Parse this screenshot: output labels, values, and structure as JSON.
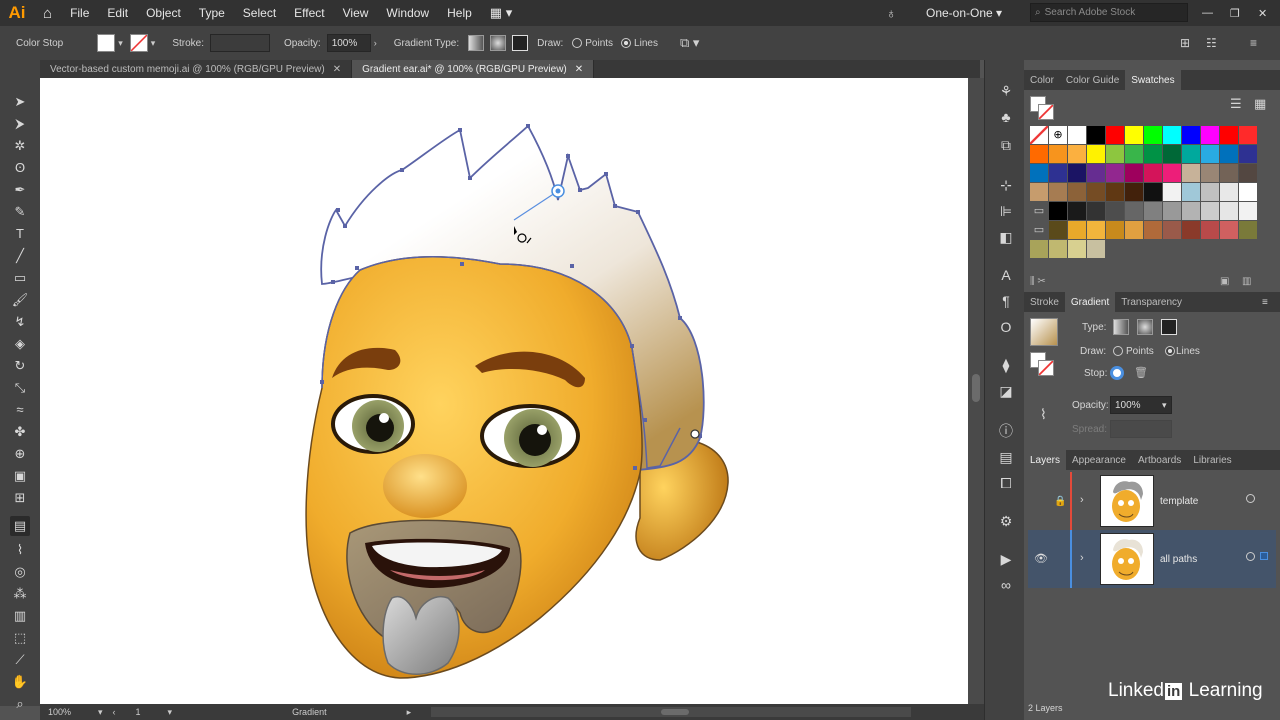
{
  "app": {
    "logo": "Ai"
  },
  "menu": [
    "File",
    "Edit",
    "Object",
    "Type",
    "Select",
    "Effect",
    "View",
    "Window",
    "Help"
  ],
  "workspace": "One-on-One",
  "search_placeholder": "Search Adobe Stock",
  "control": {
    "mode_label": "Color Stop",
    "stroke_label": "Stroke:",
    "opacity_label": "Opacity:",
    "opacity_value": "100%",
    "gradient_type_label": "Gradient Type:",
    "draw_label": "Draw:",
    "points_label": "Points",
    "lines_label": "Lines"
  },
  "tabs": [
    {
      "label": "Vector-based custom memoji.ai @ 100% (RGB/GPU Preview)",
      "active": false
    },
    {
      "label": "Gradient ear.ai* @ 100% (RGB/GPU Preview)",
      "active": true
    }
  ],
  "status": {
    "zoom": "100%",
    "artboard": "1",
    "tool": "Gradient"
  },
  "color_panel": {
    "tabs": [
      "Color",
      "Color Guide",
      "Swatches"
    ]
  },
  "gradient_panel": {
    "tabs": [
      "Stroke",
      "Gradient",
      "Transparency"
    ],
    "type_label": "Type:",
    "draw_label": "Draw:",
    "points_label": "Points",
    "lines_label": "Lines",
    "stop_label": "Stop:",
    "opacity_label": "Opacity:",
    "opacity_value": "100%",
    "spread_label": "Spread:"
  },
  "layers_panel": {
    "tabs": [
      "Layers",
      "Appearance",
      "Artboards",
      "Libraries"
    ],
    "layers": [
      {
        "name": "template",
        "locked": true
      },
      {
        "name": "all paths",
        "locked": false
      }
    ],
    "count": "2 Layers"
  },
  "watermark": "Linked in Learning",
  "colors": {
    "accent": "#4a8fe0",
    "layer_selected": "#44546a",
    "face": "#f2b53c"
  }
}
